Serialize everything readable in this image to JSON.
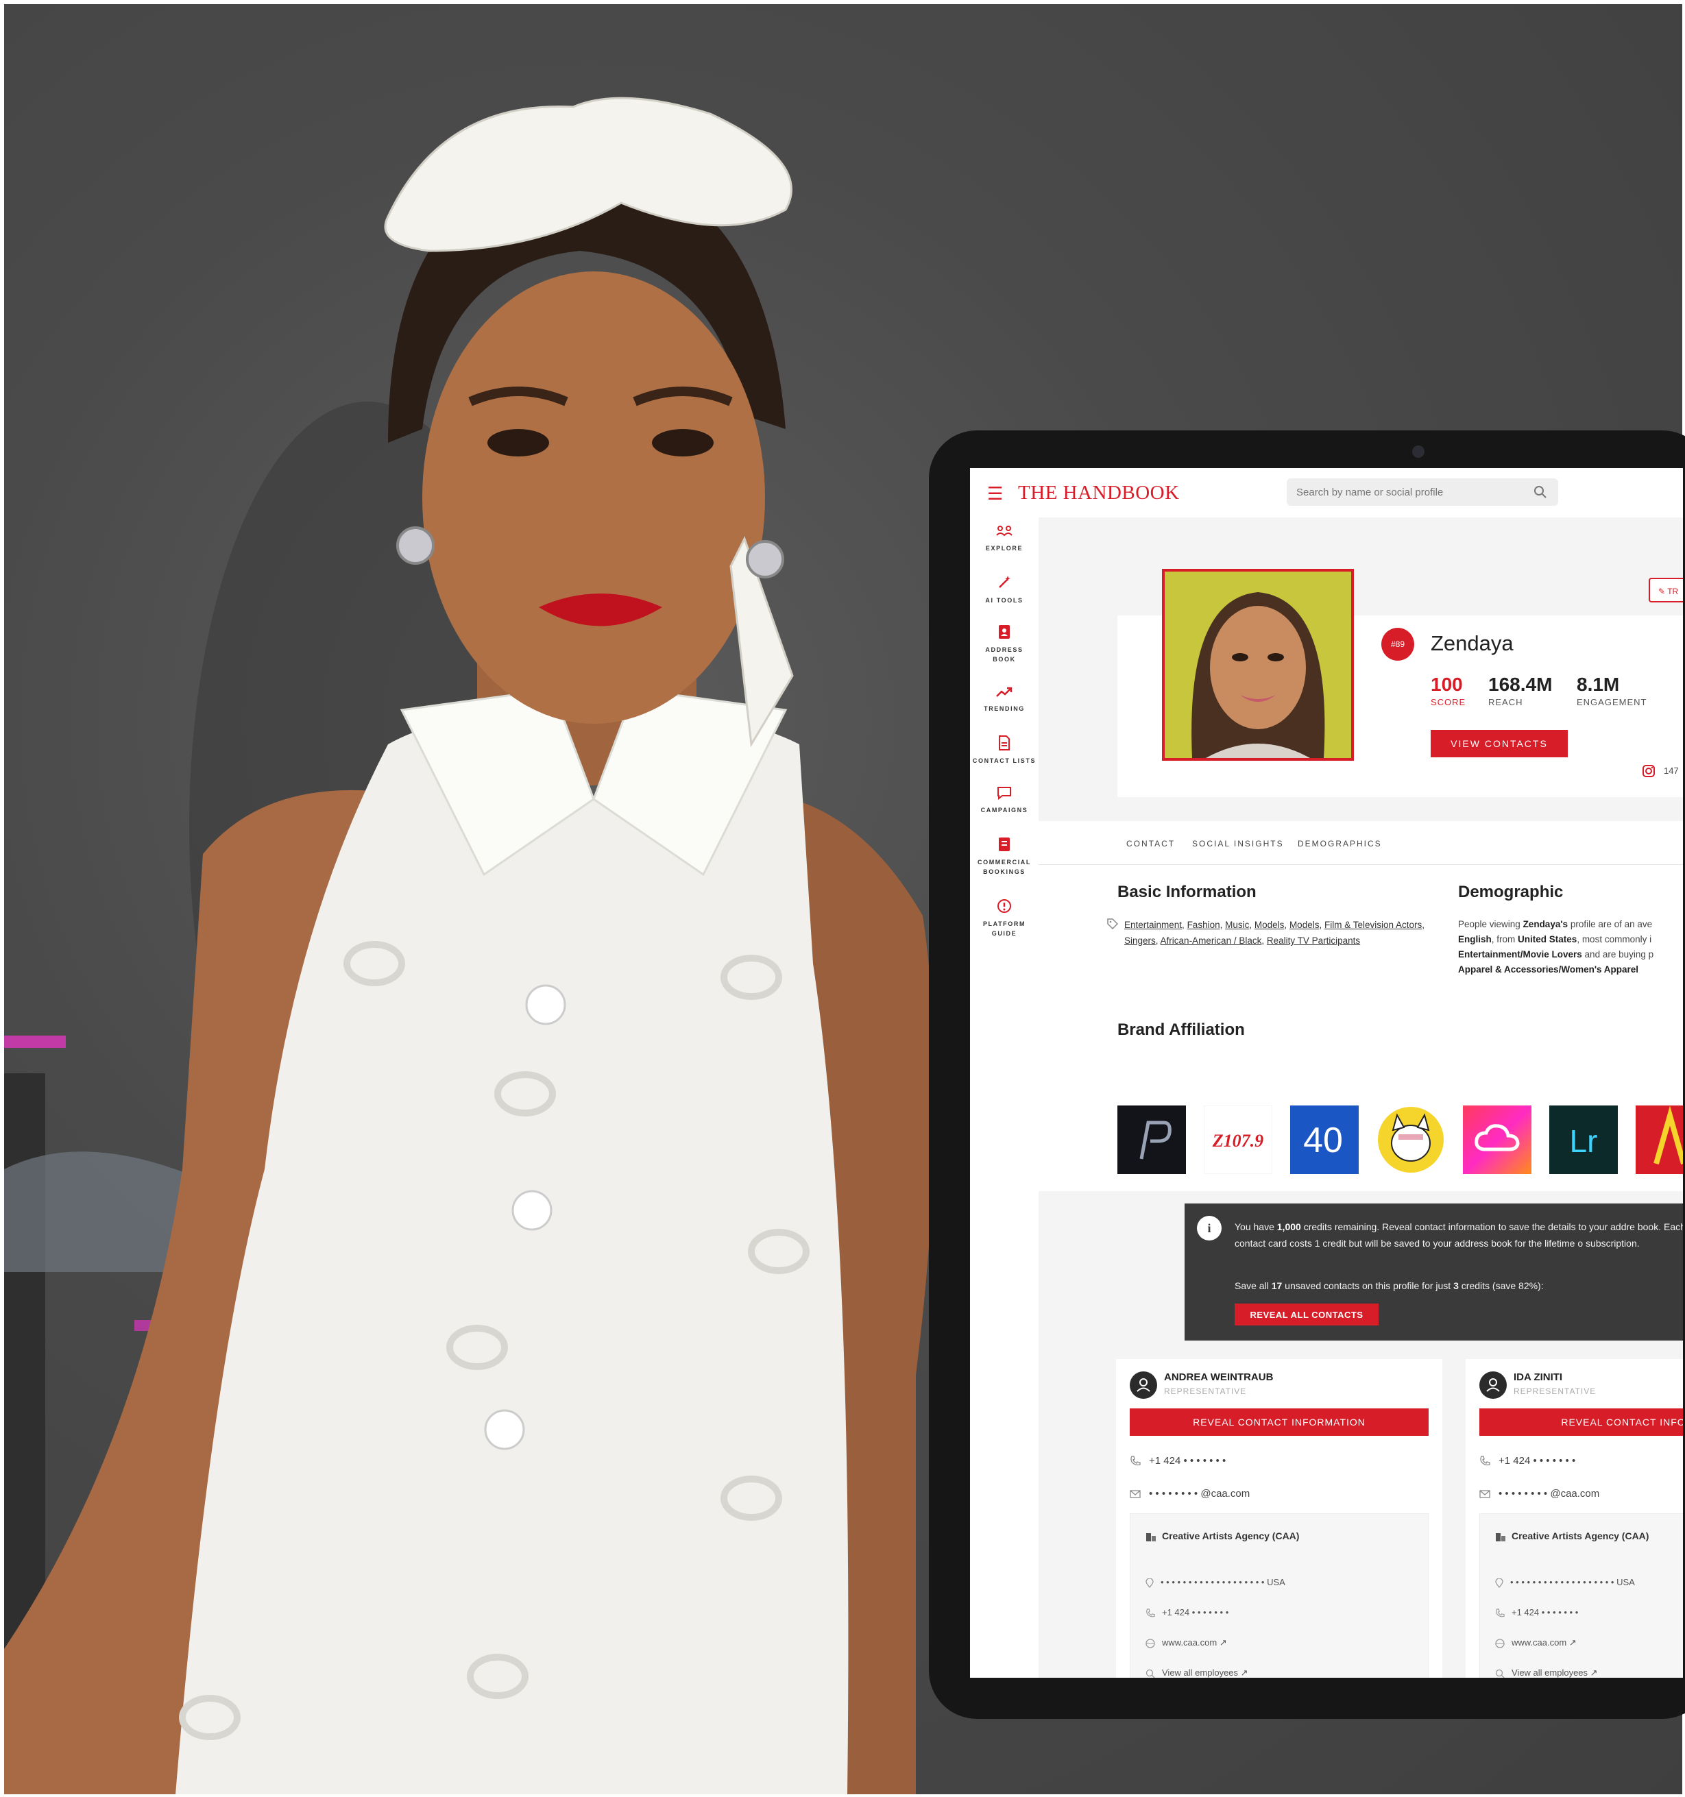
{
  "colors": {
    "accent": "#d71e28",
    "notice_bg": "#3a3a3a"
  },
  "app": {
    "brand": "THE HANDBOOK",
    "search_placeholder": "Search by name or social profile"
  },
  "sidebar": {
    "items": [
      {
        "label": "EXPLORE",
        "icon": "explore-icon"
      },
      {
        "label": "AI TOOLS",
        "icon": "magic-wand-icon"
      },
      {
        "label": "ADDRESS\nBOOK",
        "icon": "address-book-icon"
      },
      {
        "label": "TRENDING",
        "icon": "trending-icon"
      },
      {
        "label": "CONTACT LISTS",
        "icon": "document-icon"
      },
      {
        "label": "CAMPAIGNS",
        "icon": "chat-bubble-icon"
      },
      {
        "label": "COMMERCIAL\nBOOKINGS",
        "icon": "bookings-icon"
      },
      {
        "label": "PLATFORM\nGUIDE",
        "icon": "info-circle-icon"
      }
    ]
  },
  "profile": {
    "rank": "#89",
    "name": "Zendaya",
    "score_value": "100",
    "score_label": "SCORE",
    "reach_value": "168.4M",
    "reach_label": "REACH",
    "engagement_value": "8.1M",
    "engagement_label": "ENGAGEMENT",
    "view_contacts": "VIEW CONTACTS",
    "tr_button": "TR",
    "instagram_count": "147"
  },
  "tabs": [
    "CONTACT",
    "SOCIAL INSIGHTS",
    "DEMOGRAPHICS"
  ],
  "basic_info": {
    "title": "Basic Information",
    "tags": [
      "Entertainment",
      "Fashion",
      "Music",
      "Models",
      "Models",
      "Film & Television Actors",
      "Singers",
      "African-American / Black",
      "Reality TV Participants"
    ]
  },
  "demographic": {
    "title": "Demographic",
    "line1_pre": "People viewing ",
    "line1_name": "Zendaya's",
    "line1_post": " profile are of an ave",
    "line2_lang": "English",
    "line2_mid": ", from ",
    "line2_country": "United States",
    "line2_post": ", most commonly i",
    "line3_interest": "Entertainment/Movie Lovers",
    "line3_post": " and are buying p",
    "line4_category": "Apparel & Accessories/Women's Apparel"
  },
  "brand_affiliation": {
    "title": "Brand Affiliation",
    "logos": [
      "p-logo",
      "z1079-logo",
      "forty-logo",
      "french-bulldog-logo",
      "creative-cloud-logo",
      "lightroom-logo",
      "acrobat-logo"
    ],
    "z_text": "Z107.9",
    "forty_text": "40",
    "lr_text": "Lr"
  },
  "notice": {
    "pre": "You have ",
    "credits": "1,000",
    "body": " credits remaining. Reveal contact information to save the details to your addre book. Each contact card costs 1 credit but will be saved to your address book for the lifetime o subscription.",
    "save_pre": "Save all ",
    "save_count": "17",
    "save_mid": " unsaved contacts on this profile for just ",
    "save_credits": "3",
    "save_post": " credits (save 82%):",
    "button": "REVEAL ALL CONTACTS"
  },
  "contacts": [
    {
      "name": "ANDREA WEINTRAUB",
      "role": "REPRESENTATIVE",
      "button": "REVEAL CONTACT INFORMATION",
      "phone": "+1 424 • • • • • • •",
      "email": "• • • • • • • • @caa.com",
      "agency": "Creative Artists Agency (CAA)",
      "address": "• • • • • • • • • • • •  • • • • • • •  USA",
      "agency_phone": "+1 424 • • • • • • •",
      "website": "www.caa.com",
      "employees": "View all employees"
    },
    {
      "name": "IDA ZINITI",
      "role": "REPRESENTATIVE",
      "button": "REVEAL CONTACT INFORI",
      "phone": "+1 424 • • • • • • •",
      "email": "• • • • • • • • @caa.com",
      "agency": "Creative Artists Agency (CAA)",
      "address": "• • • • • • •  • • • • • • • • • • • •  USA",
      "agency_phone": "+1 424 • • • • • • •",
      "website": "www.caa.com",
      "employees": "View all employees"
    }
  ]
}
